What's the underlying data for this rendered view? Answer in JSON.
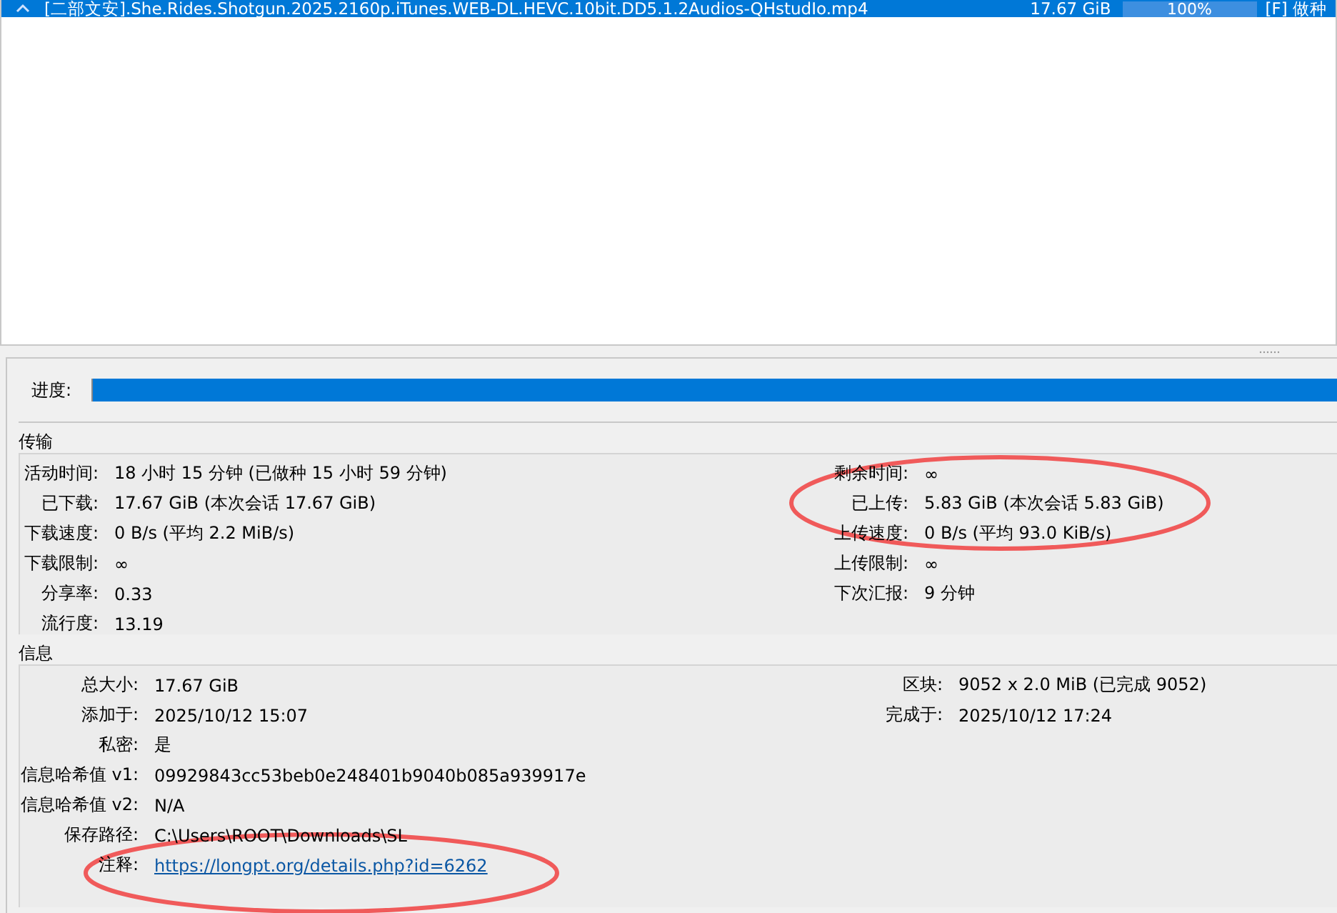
{
  "torrent_list": {
    "rows": [
      {
        "name": "[二部文安].She.Rides.Shotgun.2025.2160p.iTunes.WEB-DL.HEVC.10bit.DD5.1.2Audios-QHstudIo.mp4",
        "size": "17.67 GiB",
        "progress": {
          "level": 1,
          "text": "100%"
        },
        "status": "[F] 做种",
        "selected": true
      }
    ]
  },
  "progress": {
    "label": "进度:",
    "level": 1
  },
  "transfer": {
    "title": "传输",
    "left": [
      {
        "label": "活动时间:",
        "value": "18 小时 15 分钟 (已做种 15 小时 59 分钟)"
      },
      {
        "label": "已下载:",
        "value": "17.67 GiB (本次会话 17.67 GiB)"
      },
      {
        "label": "下载速度:",
        "value": "0 B/s (平均 2.2 MiB/s)"
      },
      {
        "label": "下载限制:",
        "value": "∞"
      },
      {
        "label": "分享率:",
        "value": "0.33"
      },
      {
        "label": "流行度:",
        "value": "13.19"
      }
    ],
    "right": [
      {
        "label": "剩余时间:",
        "value": "∞"
      },
      {
        "label": "已上传:",
        "value": "5.83 GiB (本次会话 5.83 GiB)"
      },
      {
        "label": "上传速度:",
        "value": "0 B/s (平均 93.0 KiB/s)"
      },
      {
        "label": "上传限制:",
        "value": "∞"
      },
      {
        "label": "下次汇报:",
        "value": "9 分钟"
      }
    ]
  },
  "information": {
    "title": "信息",
    "left": [
      {
        "label": "总大小:",
        "value": "17.67 GiB",
        "kind": "text"
      },
      {
        "label": "添加于:",
        "value": "2025/10/12 15:07",
        "kind": "text"
      },
      {
        "label": "私密:",
        "value": "是",
        "kind": "text"
      },
      {
        "label": "信息哈希值 v1:",
        "value": "09929843cc53beb0e248401b9040b085a939917e",
        "kind": "text"
      },
      {
        "label": "信息哈希值 v2:",
        "value": "N/A",
        "kind": "text"
      },
      {
        "label": "保存路径:",
        "value": "C:\\Users\\ROOT\\Downloads\\SL",
        "kind": "text"
      },
      {
        "label": "注释:",
        "value": "https://longpt.org/details.php?id=6262",
        "kind": "link"
      }
    ],
    "right": [
      {
        "label": "区块:",
        "value": "9052 x 2.0 MiB (已完成 9052)"
      },
      {
        "label": "完成于:",
        "value": "2025/10/12 17:24"
      }
    ]
  },
  "annotations": [
    {
      "kind": "ellipse",
      "color": "#f05a5a"
    },
    {
      "kind": "ellipse",
      "color": "#f05a5a"
    }
  ]
}
